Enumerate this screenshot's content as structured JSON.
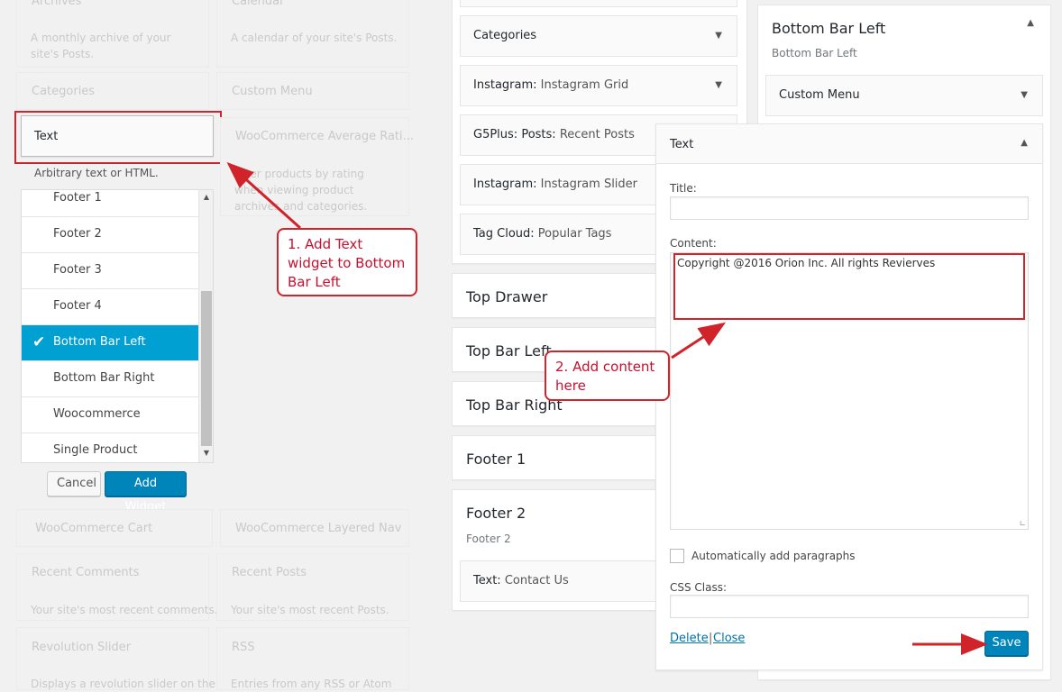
{
  "available_widgets": {
    "top_left_title": "Archives",
    "top_right_title": "Calendar",
    "archives_desc": "A monthly archive of your site's Posts.",
    "calendar_desc": "A calendar of your site's Posts.",
    "categories": "Categories",
    "custom_menu": "Custom Menu",
    "text": "Text",
    "text_desc": "Arbitrary text or HTML.",
    "woo_avg_rating": "WooCommerce Average Rati...",
    "woo_avg_desc": "Filter products by rating when viewing product archives and categories.",
    "woo_cart": "WooCommerce Cart",
    "woo_layered": "WooCommerce Layered Nav",
    "recent_comments": "Recent Comments",
    "recent_comments_desc": "Your site's most recent comments.",
    "recent_posts": "Recent Posts",
    "recent_posts_desc": "Your site's most recent Posts.",
    "revolution_slider": "Revolution Slider",
    "revolution_desc": "Displays a revolution slider on the",
    "rss": "RSS",
    "rss_desc": "Entries from any RSS or Atom"
  },
  "chooser": {
    "items": [
      "Footer 1",
      "Footer 2",
      "Footer 3",
      "Footer 4",
      "Bottom Bar Left",
      "Bottom Bar Right",
      "Woocommerce",
      "Single Product"
    ],
    "selected_index": 4,
    "check_glyph": "✔",
    "cancel_label": "Cancel",
    "add_label": "Add Widget"
  },
  "middle": {
    "widgets": [
      {
        "title": "Categories",
        "sub": ""
      },
      {
        "title": "Instagram:",
        "sub": "Instagram Grid"
      },
      {
        "title": "G5Plus: Posts:",
        "sub": "Recent Posts"
      },
      {
        "title": "Instagram:",
        "sub": "Instagram Slider"
      },
      {
        "title": "Tag Cloud:",
        "sub": "Popular Tags"
      }
    ],
    "sidebars": [
      "Top Drawer",
      "Top Bar Left",
      "Top Bar Right",
      "Footer 1"
    ],
    "footer2": {
      "title": "Footer 2",
      "sub": "Footer 2",
      "widget_title": "Text:",
      "widget_sub": "Contact Us"
    }
  },
  "right": {
    "sidebar_title": "Bottom Bar Left",
    "sidebar_sub": "Bottom Bar Left",
    "custom_menu": "Custom Menu",
    "form": {
      "header": "Text",
      "title_label": "Title:",
      "title_value": "",
      "content_label": "Content:",
      "content_value": "Copyright @2016 Orion Inc. All rights Revierves",
      "auto_paragraphs": "Automatically add paragraphs",
      "css_label": "CSS Class:",
      "css_value": "",
      "delete": "Delete",
      "separator": "|",
      "close": "Close",
      "save": "Save"
    }
  },
  "annotations": {
    "step1": "1. Add Text widget to Bottom Bar Left",
    "step2": "2. Add content here"
  },
  "colors": {
    "accent": "#0085ba",
    "selected": "#00a0d2",
    "annotation_red": "#d0232a"
  }
}
